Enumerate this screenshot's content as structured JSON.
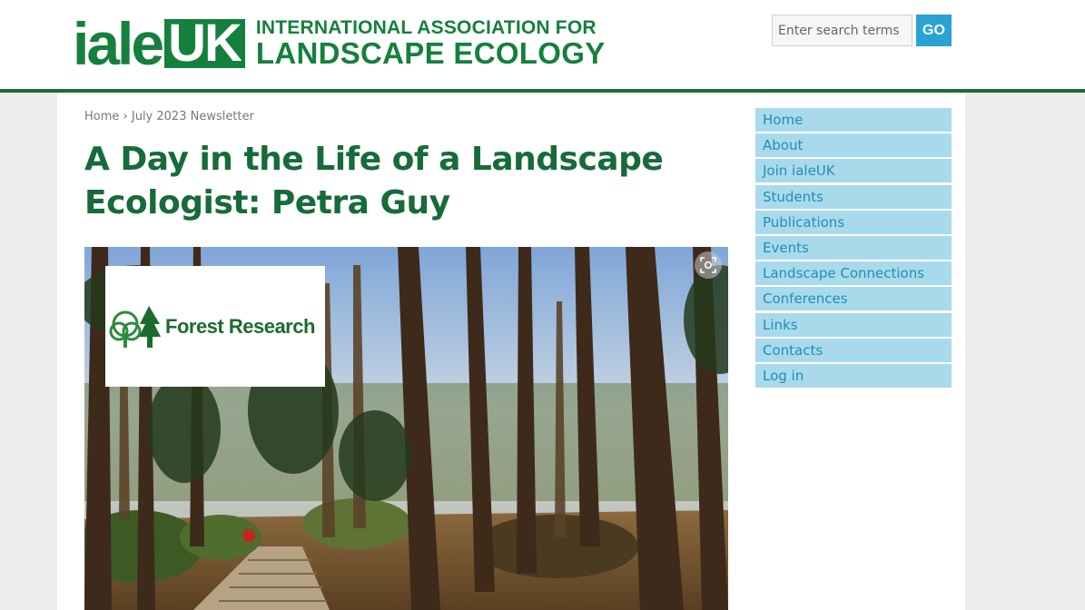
{
  "header": {
    "logo_iale": "iale",
    "logo_uk": "UK",
    "logo_line1": "INTERNATIONAL ASSOCIATION FOR",
    "logo_line2": "LANDSCAPE ECOLOGY"
  },
  "search": {
    "placeholder": "Enter search terms",
    "value": "",
    "go_label": "GO"
  },
  "breadcrumb": {
    "home": "Home",
    "separator": "›",
    "current": "July 2023 Newsletter"
  },
  "page": {
    "title": "A Day in the Life of a Landscape Ecologist: Petra Guy"
  },
  "image": {
    "overlay_logo_text": "Forest Research",
    "overlay_icon": "tree-logo-icon",
    "action_icon": "camera-scan-icon"
  },
  "sidebar": {
    "items": [
      {
        "label": "Home"
      },
      {
        "label": "About"
      },
      {
        "label": "Join ialeUK"
      },
      {
        "label": "Students"
      },
      {
        "label": "Publications"
      },
      {
        "label": "Events"
      },
      {
        "label": "Landscape Connections"
      },
      {
        "label": "Conferences"
      },
      {
        "label": "Links"
      },
      {
        "label": "Contacts"
      },
      {
        "label": "Log in"
      }
    ]
  },
  "colors": {
    "brand_green": "#15803d",
    "title_green": "#176b3a",
    "header_rule": "#1d6b38",
    "sidebar_bg": "#a9daeb",
    "sidebar_text": "#1f8fb6",
    "go_button": "#29a3d4"
  }
}
